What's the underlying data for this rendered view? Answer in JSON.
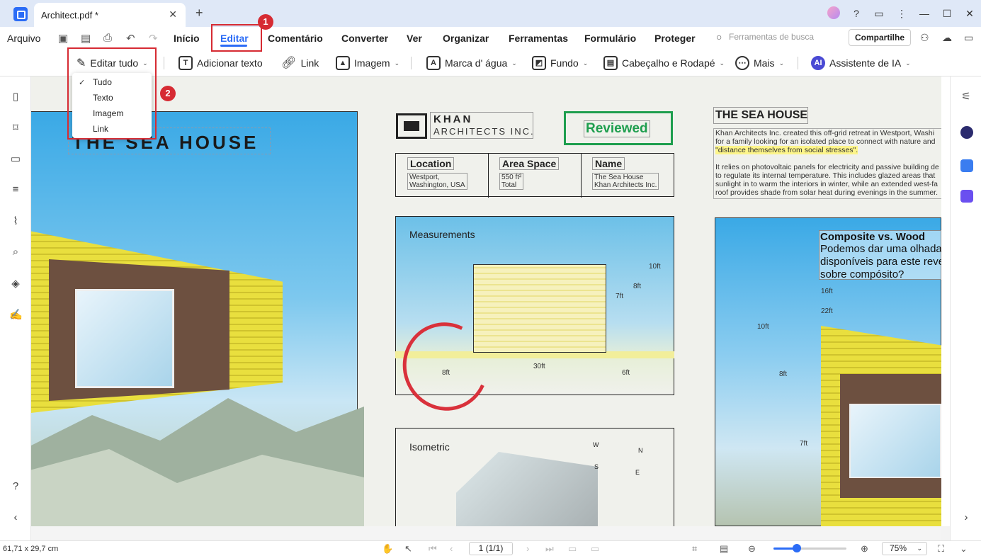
{
  "app": {
    "tab_title": "Architect.pdf *"
  },
  "menu": {
    "file": "Arquivo",
    "items": [
      "Início",
      "Editar",
      "Comentário",
      "Converter",
      "Ver",
      "Organizar",
      "Ferramentas",
      "Formulário",
      "Proteger"
    ],
    "active": "Editar",
    "search_placeholder": "Ferramentas de busca",
    "share_label": "Compartilhe"
  },
  "toolbar": {
    "edit_all": "Editar tudo",
    "add_text": "Adicionar texto",
    "link": "Link",
    "image": "Imagem",
    "watermark": "Marca d' água",
    "background": "Fundo",
    "header_footer": "Cabeçalho e Rodapé",
    "more": "Mais",
    "ai_assistant": "Assistente de IA"
  },
  "dropdown": {
    "items": [
      "Tudo",
      "Texto",
      "Imagem",
      "Link"
    ],
    "selected": "Tudo"
  },
  "annotations": {
    "badge1": "1",
    "badge2": "2"
  },
  "document": {
    "sea_title": "THE SEA HOUSE",
    "khan_line1": "KHAN",
    "khan_line2": "ARCHITECTS INC.",
    "reviewed": "Reviewed",
    "info": {
      "location_h": "Location",
      "location_v1": "Westport,",
      "location_v2": "Washington, USA",
      "area_h": "Area Space",
      "area_v1": "550 ft²",
      "area_v2": "Total",
      "name_h": "Name",
      "name_v1": "The Sea House",
      "name_v2": "Khan Architects Inc."
    },
    "measurements": {
      "title": "Measurements",
      "labels": {
        "l10ft": "10ft",
        "l8ft": "8ft",
        "l7ft": "7ft",
        "l8ftb": "8ft",
        "l30ft": "30ft",
        "l6ft": "6ft"
      }
    },
    "isometric": {
      "title": "Isometric",
      "w": "W",
      "n": "N",
      "s": "S",
      "e": "E"
    },
    "right_title": "THE SEA HOUSE",
    "right_body": {
      "l1": "Khan Architects Inc. created this off-grid retreat in Westport, Washi",
      "l2": "for a family looking for an isolated place to connect with nature and",
      "l3": "\"distance themselves from social stresses\".",
      "l4": "It relies on photovoltaic panels for electricity and passive building de",
      "l5": "to regulate its internal temperature. This includes glazed areas that",
      "l6": "sunlight in to warm the interiors in winter, while an extended west-fa",
      "l7": "roof provides shade from solar heat during evenings in the summer."
    },
    "composite": {
      "title": "Composite vs. Wood",
      "l1": "Podemos dar uma olhada",
      "l2": "disponíveis para este reve",
      "l3": "sobre compósito?",
      "d16": "16ft",
      "d22": "22ft",
      "d10": "10ft",
      "d8": "8ft",
      "d7": "7ft"
    }
  },
  "status": {
    "coords": "61,71 x 29,7 cm",
    "page": "1 (1/1)",
    "zoom_level": "75%",
    "zoom_fraction": 0.32
  }
}
